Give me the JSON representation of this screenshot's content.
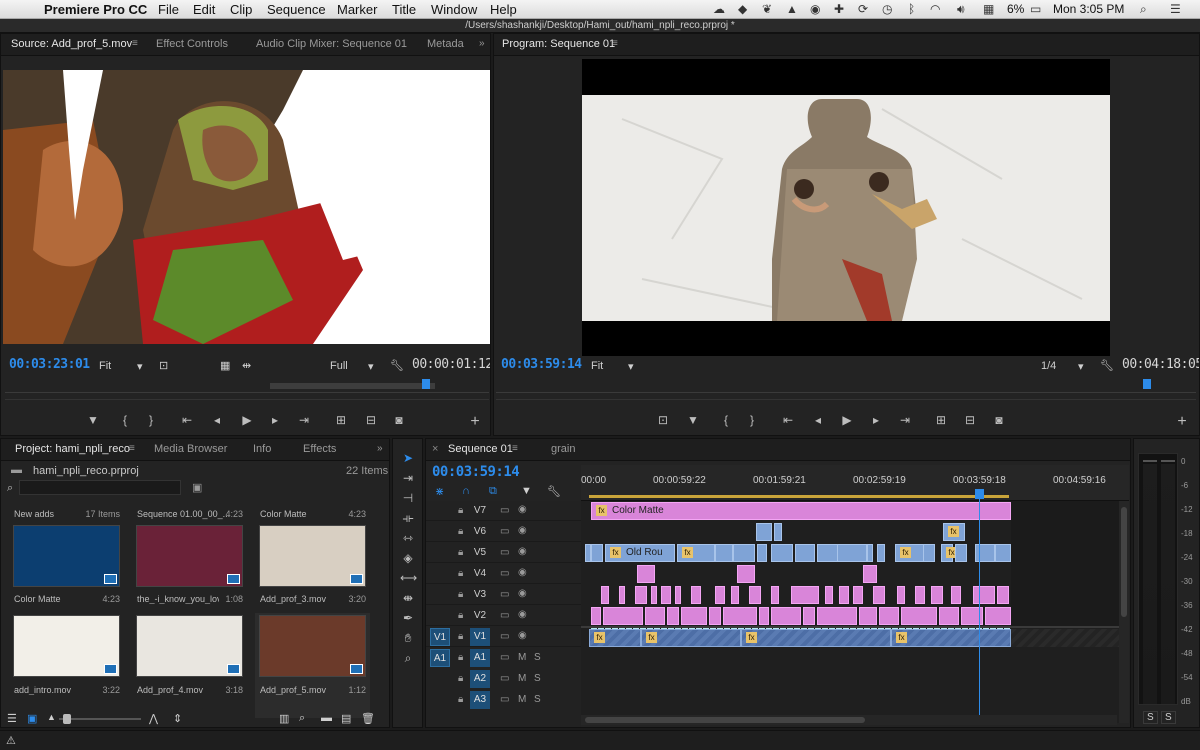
{
  "menubar": {
    "app_name": "Premiere Pro CC",
    "items": [
      "File",
      "Edit",
      "Clip",
      "Sequence",
      "Marker",
      "Title",
      "Window",
      "Help"
    ],
    "battery": "6%",
    "clock": "Mon 3:05 PM"
  },
  "titlebar": {
    "path": "/Users/shashankji/Desktop/Hami_out/hami_npli_reco.prproj *"
  },
  "source": {
    "tabs": [
      "Source: Add_prof_5.mov",
      "Effect Controls",
      "Audio Clip Mixer: Sequence 01",
      "Metada"
    ],
    "timecode": "00:03:23:01",
    "fit": "Fit",
    "resolution": "Full",
    "duration": "00:00:01:12",
    "playhead_fraction": 0.87
  },
  "program": {
    "tab": "Program: Sequence 01",
    "timecode": "00:03:59:14",
    "fit": "Fit",
    "resolution": "1/4",
    "duration": "00:04:18:05",
    "playhead_fraction": 0.93
  },
  "project": {
    "tabs": [
      "Project: hami_npli_reco",
      "Media Browser",
      "Info",
      "Effects"
    ],
    "filename": "hami_npli_reco.prproj",
    "items_count": "22 Items",
    "bins": [
      {
        "top": "New adds",
        "topright": "17 Items",
        "label": "Color Matte",
        "dur": "4:23",
        "color": "#0c3e70"
      },
      {
        "top": "Sequence 01.00_00_...",
        "topright": "4:23",
        "label": "the_-i_know_you_lov...",
        "dur": "1:08",
        "color": "#6a2238"
      },
      {
        "top": "Color Matte",
        "topright": "4:23",
        "label": "Add_prof_3.mov",
        "dur": "3:20",
        "color": "#d8cfc2"
      },
      {
        "top": "",
        "topright": "",
        "label": "add_intro.mov",
        "dur": "3:22",
        "color": "#f2efe8"
      },
      {
        "top": "",
        "topright": "",
        "label": "Add_prof_4.mov",
        "dur": "3:18",
        "color": "#e9e6e0"
      },
      {
        "top": "",
        "topright": "",
        "label": "Add_prof_5.mov",
        "dur": "1:12",
        "color": "#6b3a2a"
      }
    ]
  },
  "timeline": {
    "tabs": [
      "Sequence 01",
      "grain"
    ],
    "timecode": "00:03:59:14",
    "ruler": [
      "00:00",
      "00:00:59:22",
      "00:01:59:21",
      "00:02:59:19",
      "00:03:59:18",
      "00:04:59:16"
    ],
    "video_tracks": [
      "V7",
      "V6",
      "V5",
      "V4",
      "V3",
      "V2",
      "V1"
    ],
    "audio_tracks": [
      "A1",
      "A2",
      "A3"
    ],
    "v1_source": "V1",
    "a1_source": "A1",
    "clip_labels": {
      "color_matte": "Color Matte",
      "old_rou": "Old Rou"
    },
    "mute": "M",
    "solo": "S"
  },
  "meter": {
    "scale": [
      "0",
      "-6",
      "-12",
      "-18",
      "-24",
      "-30",
      "-36",
      "-42",
      "-48",
      "-54",
      "dB"
    ],
    "solo_left": "S",
    "solo_right": "S"
  },
  "icons": {
    "apple": "apple-icon",
    "wifi": "wifi-icon",
    "play": "play-icon",
    "wrench": "wrench-icon"
  }
}
